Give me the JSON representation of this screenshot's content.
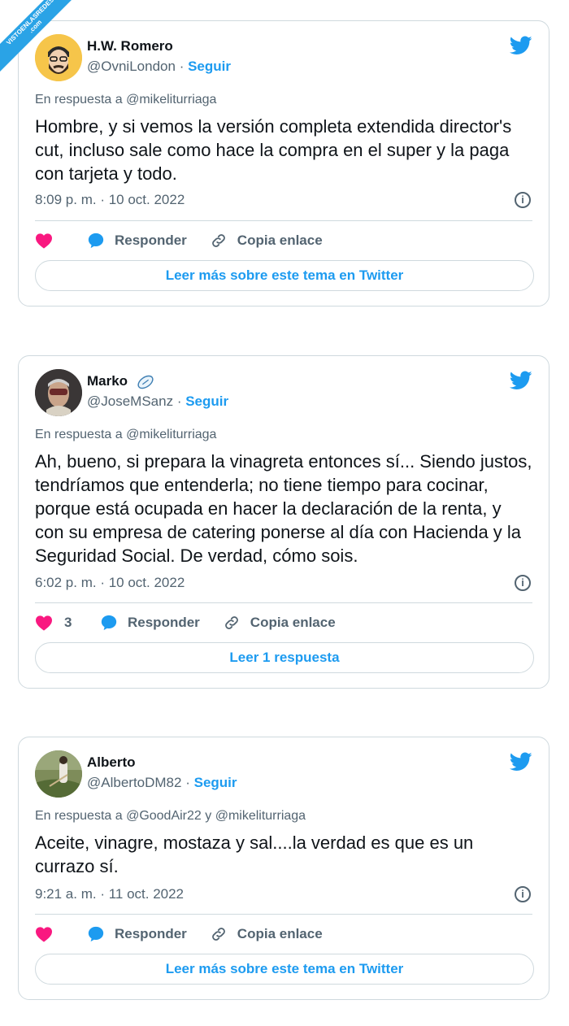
{
  "watermark": {
    "line1": "VISTOENLASREDES",
    "line2": ".com"
  },
  "colors": {
    "accent": "#1d9bf0",
    "like": "#f91880",
    "muted": "#536471",
    "text": "#0f1419"
  },
  "tweets": [
    {
      "name": "H.W. Romero",
      "handle": "@OvniLondon",
      "sep": "·",
      "follow": "Seguir",
      "reply_to": "En respuesta a @mikeliturriaga",
      "text": "Hombre, y si vemos la versión completa extendida director's cut, incluso sale como hace la compra en el super y la paga con tarjeta y todo.",
      "time": "8:09 p. m. · 10 oct. 2022",
      "likes": "",
      "reply_label": "Responder",
      "copy_label": "Copia enlace",
      "more_label": "Leer más sobre este tema en Twitter"
    },
    {
      "name": "Marko",
      "handle": "@JoseMSanz",
      "sep": "·",
      "follow": "Seguir",
      "reply_to": "En respuesta a @mikeliturriaga",
      "text": "Ah, bueno, si prepara la vinagreta entonces sí... Siendo justos, tendríamos que entenderla; no tiene tiempo para cocinar, porque está ocupada en hacer la declaración de la renta, y con su empresa de catering ponerse al día con Hacienda y la Seguridad Social. De verdad, cómo sois.",
      "time": "6:02 p. m. · 10 oct. 2022",
      "likes": "3",
      "reply_label": "Responder",
      "copy_label": "Copia enlace",
      "more_label": "Leer 1 respuesta"
    },
    {
      "name": "Alberto",
      "handle": "@AlbertoDM82",
      "sep": "·",
      "follow": "Seguir",
      "reply_to": "En respuesta a @GoodAir22 y @mikeliturriaga",
      "text": "Aceite, vinagre, mostaza y sal....la verdad es que es un currazo sí.",
      "time": "9:21 a. m. · 11 oct. 2022",
      "likes": "",
      "reply_label": "Responder",
      "copy_label": "Copia enlace",
      "more_label": "Leer más sobre este tema en Twitter"
    }
  ],
  "icons": {
    "bird": "twitter-bird-icon",
    "heart": "heart-icon",
    "reply": "speech-bubble-icon",
    "link": "link-icon",
    "info": "info-icon",
    "emoji": "rugby-ball-icon"
  }
}
